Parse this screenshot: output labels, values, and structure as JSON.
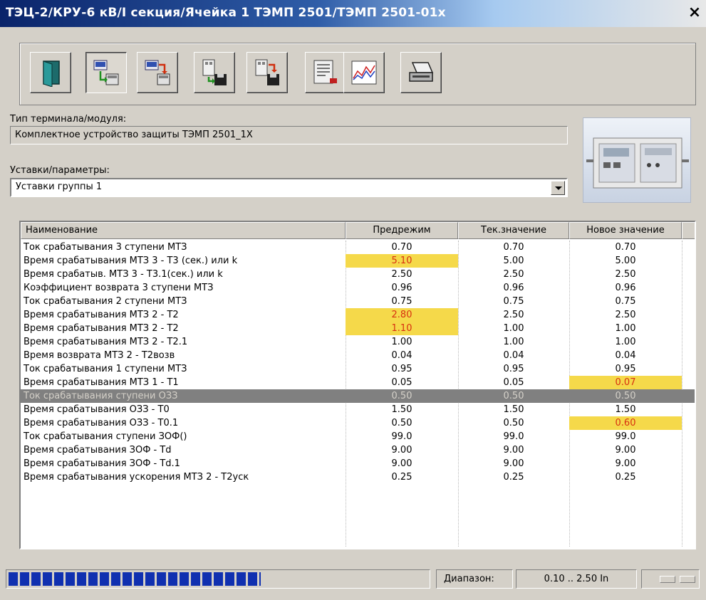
{
  "window": {
    "title": "ТЭЦ-2/КРУ-6 кВ/I секция/Ячейка 1 ТЭМП 2501/ТЭМП 2501-01х",
    "close_label": "×"
  },
  "toolbar": {
    "buttons": [
      {
        "icon": "door-exit-icon"
      },
      {
        "icon": "read-from-device-icon"
      },
      {
        "icon": "write-to-device-icon"
      },
      {
        "icon": "load-from-disk-icon"
      },
      {
        "icon": "save-to-disk-icon"
      },
      {
        "icon": "report-icon"
      },
      {
        "icon": "oscillogram-icon"
      },
      {
        "icon": "print-icon"
      }
    ]
  },
  "terminal": {
    "label": "Тип терминала/модуля:",
    "value": "Комплектное устройство защиты ТЭМП 2501_1Х"
  },
  "settings": {
    "label": "Уставки/параметры:",
    "selected": "Уставки группы 1"
  },
  "table": {
    "columns": [
      "Наименование",
      "Предрежим",
      "Тек.значение",
      "Новое значение"
    ],
    "rows": [
      {
        "name": "Ток срабатывания 3 ступени МТЗ",
        "pre": "0.70",
        "cur": "0.70",
        "new": "0.70"
      },
      {
        "name": "Время срабатывания МТЗ 3 - Т3 (сек.) или k",
        "pre": "5.10",
        "cur": "5.00",
        "new": "5.00",
        "hl_pre": true
      },
      {
        "name": "Время срабатыв. МТЗ 3 - Т3.1(сек.) или k",
        "pre": "2.50",
        "cur": "2.50",
        "new": "2.50"
      },
      {
        "name": "Коэффициент возврата 3 ступени МТЗ",
        "pre": "0.96",
        "cur": "0.96",
        "new": "0.96"
      },
      {
        "name": "Ток срабатывания 2 ступени МТЗ",
        "pre": "0.75",
        "cur": "0.75",
        "new": "0.75"
      },
      {
        "name": "Время срабатывания МТЗ 2 - Т2",
        "pre": "2.80",
        "cur": "2.50",
        "new": "2.50",
        "hl_pre": true
      },
      {
        "name": "Время срабатывания МТЗ 2 - Т2",
        "pre": "1.10",
        "cur": "1.00",
        "new": "1.00",
        "hl_pre": true
      },
      {
        "name": "Время срабатывания МТЗ 2 - Т2.1",
        "pre": "1.00",
        "cur": "1.00",
        "new": "1.00"
      },
      {
        "name": "Время возврата МТЗ 2 - Т2возв",
        "pre": "0.04",
        "cur": "0.04",
        "new": "0.04"
      },
      {
        "name": "Ток срабатывания 1 ступени МТЗ",
        "pre": "0.95",
        "cur": "0.95",
        "new": "0.95"
      },
      {
        "name": "Время срабатывания МТЗ 1 - Т1",
        "pre": "0.05",
        "cur": "0.05",
        "new": "0.07",
        "hl_new": true
      },
      {
        "name": "Ток срабатывания ступени ОЗЗ",
        "pre": "0.50",
        "cur": "0.50",
        "new": "0.50",
        "selected": true
      },
      {
        "name": "Время срабатывания ОЗЗ - Т0",
        "pre": "1.50",
        "cur": "1.50",
        "new": "1.50"
      },
      {
        "name": "Время срабатывания ОЗЗ - Т0.1",
        "pre": "0.50",
        "cur": "0.50",
        "new": "0.60",
        "hl_new": true
      },
      {
        "name": "Ток срабатывания ступени ЗОФ()",
        "pre": "99.0",
        "cur": "99.0",
        "new": "99.0"
      },
      {
        "name": "Время срабатывания ЗОФ - Td",
        "pre": "9.00",
        "cur": "9.00",
        "new": "9.00"
      },
      {
        "name": "Время срабатывания ЗОФ - Td.1",
        "pre": "9.00",
        "cur": "9.00",
        "new": "9.00"
      },
      {
        "name": "Время срабатывания ускорения МТЗ 2 - Т2уск",
        "pre": "0.25",
        "cur": "0.25",
        "new": "0.25"
      }
    ]
  },
  "status": {
    "progress": 0.6,
    "range_label": "Диапазон:",
    "range_value": "0.10 .. 2.50 In"
  },
  "colors": {
    "highlight_bg": "#f5d94a",
    "highlight_text": "#d83010",
    "selected_row": "#808080",
    "progress": "#1030b0"
  }
}
